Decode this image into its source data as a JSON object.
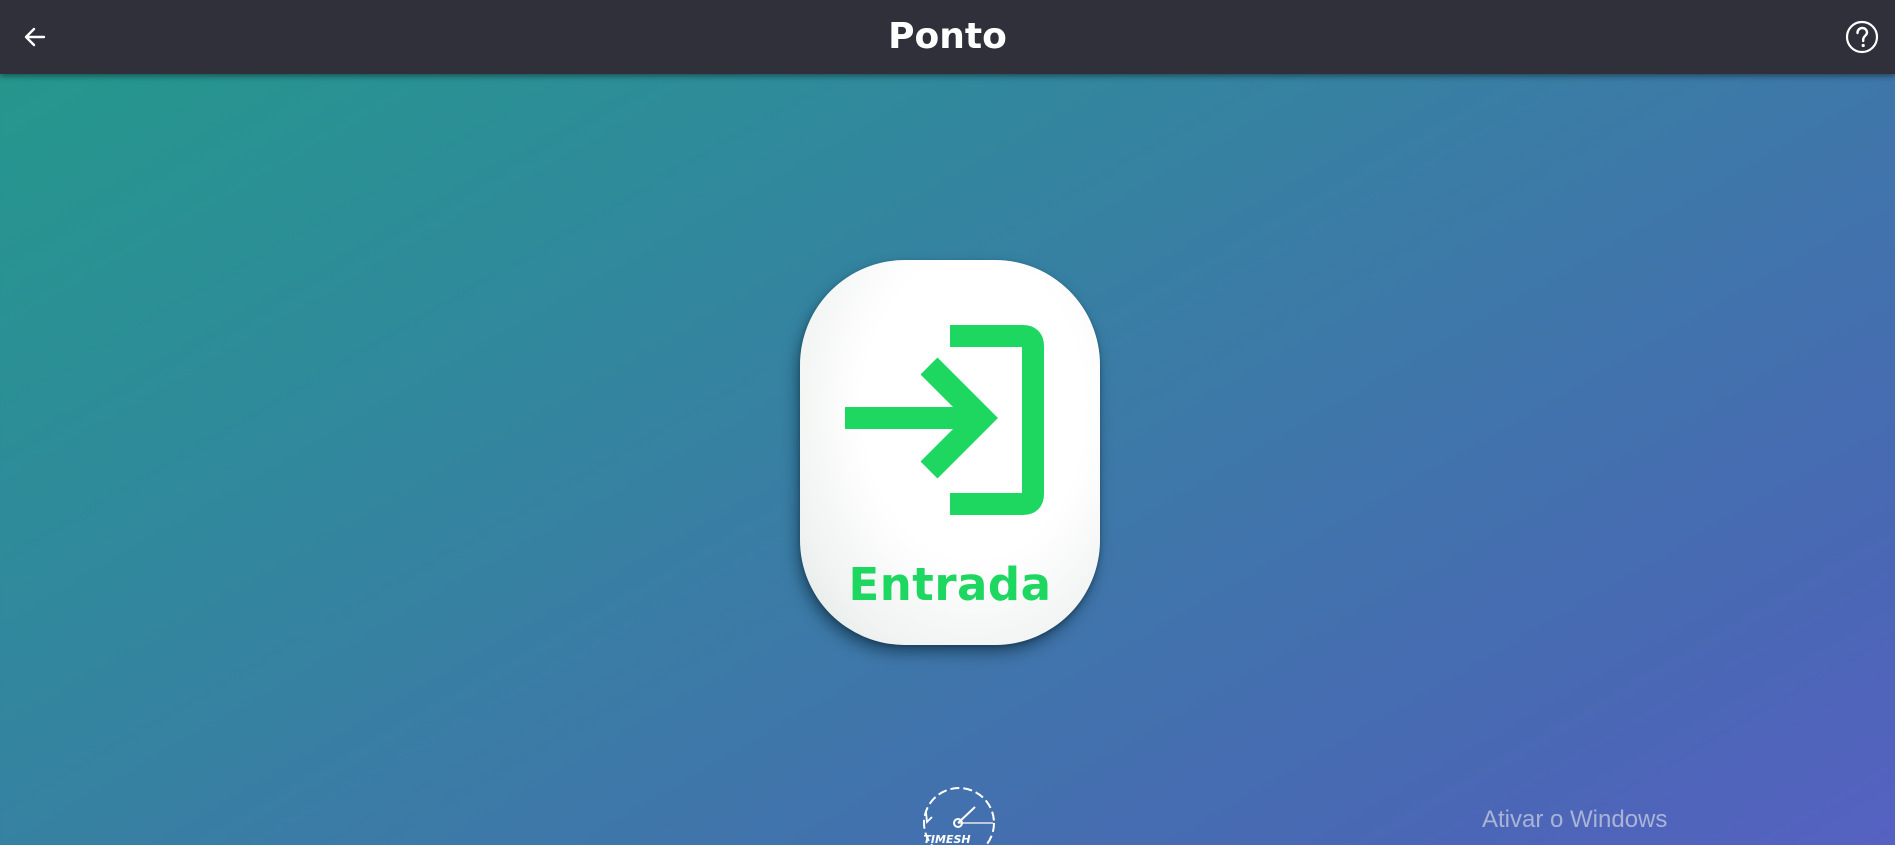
{
  "header": {
    "title": "Ponto",
    "back_icon": "arrow-left-icon",
    "help_icon": "help-circle-icon"
  },
  "main": {
    "entry_button": {
      "label": "Entrada",
      "icon": "login-arrow-icon",
      "accent_color": "#1ed760"
    }
  },
  "footer": {
    "logo_icon": "timesh-clock-logo",
    "logo_text": "TIMESH"
  },
  "system": {
    "watermark": "Ativar o Windows"
  },
  "colors": {
    "topbar": "#30303b",
    "gradient_start": "#23998a",
    "gradient_end": "#5661c2",
    "accent": "#1ed760"
  }
}
